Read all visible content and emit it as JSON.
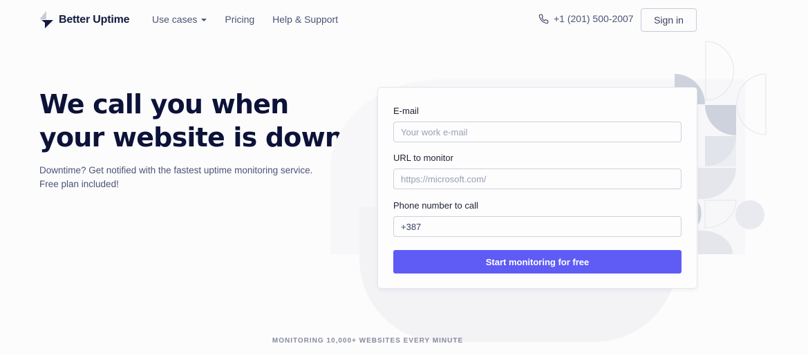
{
  "header": {
    "brand": "Better Uptime",
    "nav": [
      {
        "label": "Use cases",
        "has_dropdown": true
      },
      {
        "label": "Pricing"
      },
      {
        "label": "Help & Support"
      }
    ],
    "phone": "+1 (201) 500-2007",
    "signin_label": "Sign in"
  },
  "hero": {
    "title_line1": "We call you when",
    "title_line2": "your website is down",
    "subtitle": "Downtime? Get notified with the fastest uptime monitoring service. Free plan included!"
  },
  "form": {
    "email_label": "E-mail",
    "email_placeholder": "Your work e-mail",
    "email_value": "",
    "url_label": "URL to monitor",
    "url_placeholder": "https://microsoft.com/",
    "url_value": "",
    "phone_label": "Phone number to call",
    "phone_value": "+387",
    "submit_label": "Start monitoring for free"
  },
  "tagline": "MONITORING 10,000+ WEBSITES EVERY MINUTE",
  "colors": {
    "accent": "#5f5bf5",
    "heading": "#0c1238",
    "text_muted": "#4b5375"
  }
}
